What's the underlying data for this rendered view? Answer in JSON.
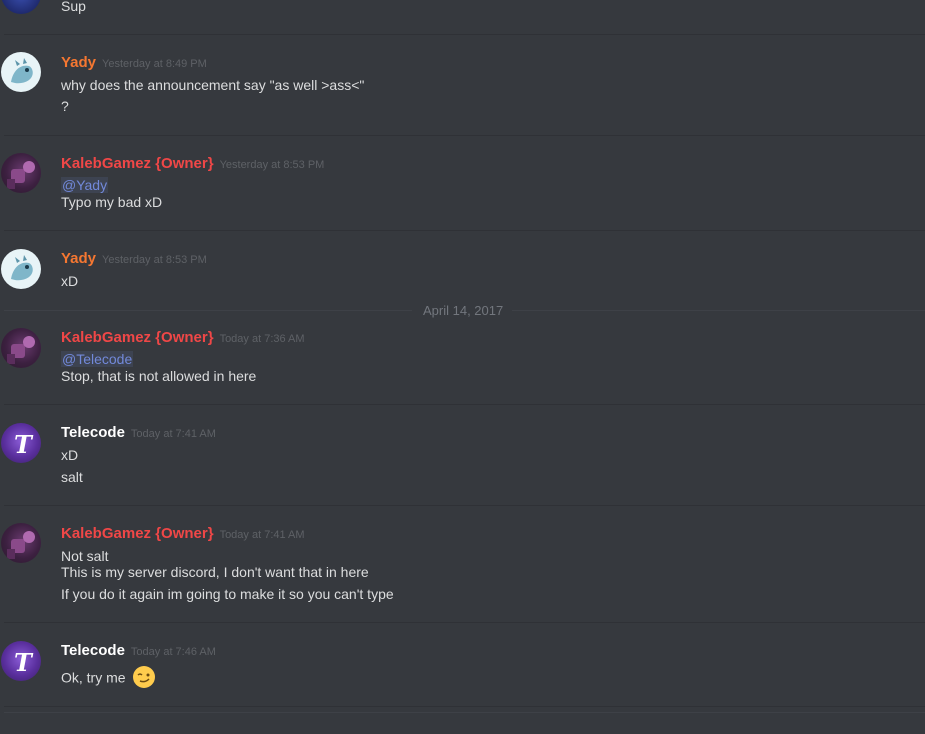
{
  "colors": {
    "background": "#36393e",
    "owner_name": "#f04747",
    "yady_name": "#f57731",
    "telecode_name": "#ffffff",
    "mention": "#7289da"
  },
  "top_fragment": {
    "text": "Sup"
  },
  "messages": [
    {
      "author": "Yady",
      "timestamp": "Yesterday at 8:49 PM",
      "lines": [
        "why does the announcement say \"as well >ass<\"",
        "?"
      ]
    },
    {
      "author": "KalebGamez {Owner}",
      "timestamp": "Yesterday at 8:53 PM",
      "mention": "@Yady",
      "lines": [
        "Typo my bad xD"
      ]
    },
    {
      "author": "Yady",
      "timestamp": "Yesterday at 8:53 PM",
      "lines": [
        "xD"
      ]
    },
    {
      "author": "KalebGamez {Owner}",
      "timestamp": "Today at 7:36 AM",
      "mention": "@Telecode",
      "lines": [
        "Stop, that is not allowed in here"
      ]
    },
    {
      "author": "Telecode",
      "timestamp": "Today at 7:41 AM",
      "lines": [
        "xD",
        "salt"
      ]
    },
    {
      "author": "KalebGamez {Owner}",
      "timestamp": "Today at 7:41 AM",
      "lines": [
        "Not salt",
        "This is my server discord, I don't want that in here",
        "If you do it again im going to make it so you can't type"
      ]
    },
    {
      "author": "Telecode",
      "timestamp": "Today at 7:46 AM",
      "lines": [
        "Ok, try me"
      ],
      "emoji": "smirk-wink-emoji"
    }
  ],
  "date_separator": "April 14, 2017"
}
